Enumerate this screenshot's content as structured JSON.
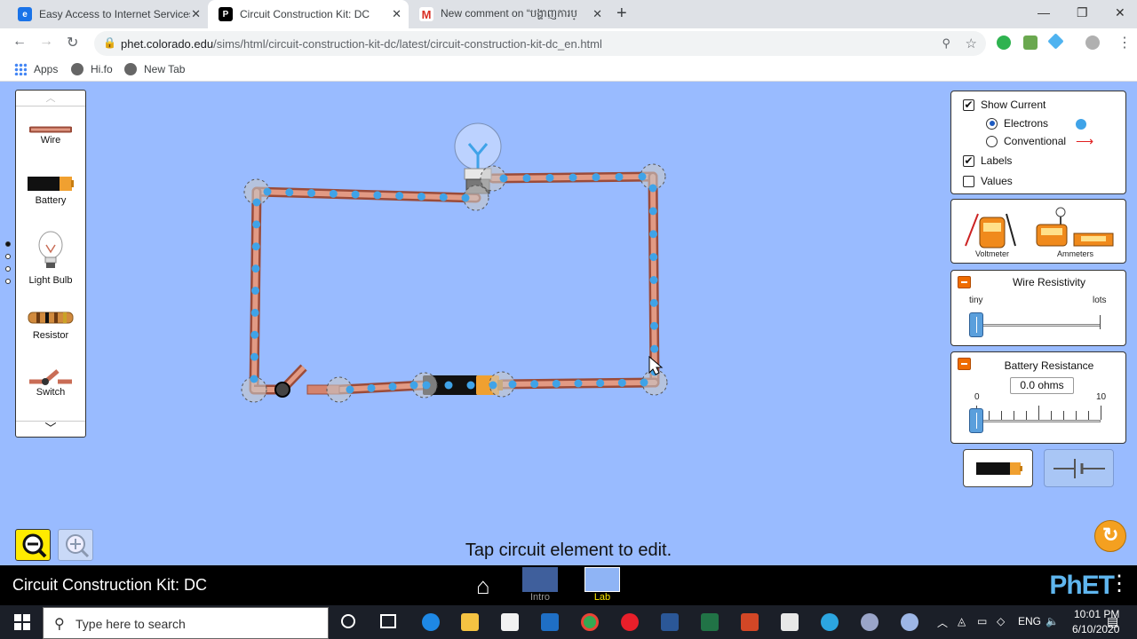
{
  "browser": {
    "tabs": [
      {
        "title": "Easy Access to Internet Services",
        "active": false,
        "favicon_color": "#1a73e8"
      },
      {
        "title": "Circuit Construction Kit: DC",
        "active": true,
        "favicon_color": "#000000"
      },
      {
        "title": "New comment on “បង្ហាញការប្",
        "active": false,
        "favicon_color": "#d93025"
      }
    ],
    "url_host": "phet.colorado.edu",
    "url_path": "/sims/html/circuit-construction-kit-dc/latest/circuit-construction-kit-dc_en.html",
    "bookmarks": [
      "Apps",
      "Hi.fo",
      "New Tab"
    ]
  },
  "toolbox": {
    "items": [
      "Wire",
      "Battery",
      "Light Bulb",
      "Resistor",
      "Switch"
    ]
  },
  "controls": {
    "show_current": "Show Current",
    "electrons": "Electrons",
    "conventional": "Conventional",
    "labels": "Labels",
    "values": "Values",
    "show_current_checked": true,
    "electrons_selected": true,
    "labels_checked": true,
    "values_checked": false
  },
  "sensors": {
    "voltmeter": "Voltmeter",
    "ammeters": "Ammeters"
  },
  "wire_resistivity": {
    "title": "Wire Resistivity",
    "min_label": "tiny",
    "max_label": "lots",
    "level": 0
  },
  "battery_resistance": {
    "title": "Battery Resistance",
    "value": "0.0 ohms",
    "min_label": "0",
    "max_label": "10",
    "level": 0
  },
  "status_message": "Tap circuit element to edit.",
  "navbar": {
    "sim_title": "Circuit Construction Kit: DC",
    "screens": [
      "Intro",
      "Lab"
    ],
    "logo": "PhET"
  },
  "taskbar": {
    "search_placeholder": "Type here to search",
    "language": "ENG",
    "time": "10:01 PM",
    "date": "6/10/2020"
  },
  "colors": {
    "sim_background": "#99bbff",
    "wire": "#d4836e",
    "electron": "#3fa3e8",
    "accent_orange": "#ef6c00"
  }
}
